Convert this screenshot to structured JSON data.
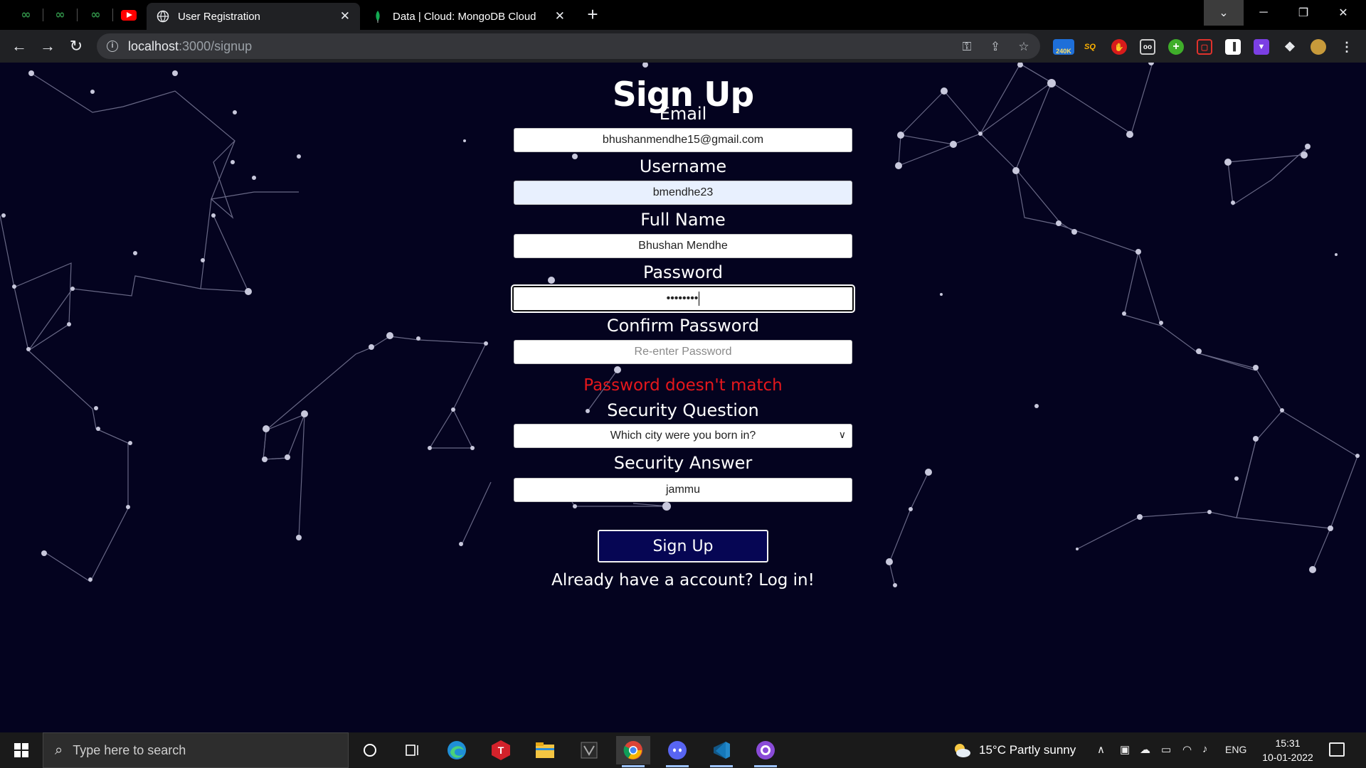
{
  "browser": {
    "tabs": [
      {
        "label": "User Registration",
        "active": true
      },
      {
        "label": "Data | Cloud: MongoDB Cloud",
        "active": false
      }
    ],
    "pinned_tabs": [
      "gfg-icon",
      "gfg-icon",
      "gfg-icon",
      "youtube-icon"
    ],
    "url": {
      "host": "localhost",
      "path": ":3000/signup"
    },
    "extension_badge": "240K",
    "extension_sq": "SQ"
  },
  "signup": {
    "title": "Sign Up",
    "email_label": "Email",
    "email_value": "bhushanmendhe15@gmail.com",
    "username_label": "Username",
    "username_value": "bmendhe23",
    "fullname_label": "Full Name",
    "fullname_value": "Bhushan Mendhe",
    "password_label": "Password",
    "password_value": "••••••••",
    "confirm_label": "Confirm Password",
    "confirm_placeholder": "Re-enter Password",
    "error_message": "Password doesn't match",
    "question_label": "Security Question",
    "question_value": "Which city were you born in?",
    "answer_label": "Security Answer",
    "answer_value": "jammu",
    "submit_label": "Sign Up",
    "login_text": "Already have a account? Log in!"
  },
  "taskbar": {
    "search_placeholder": "Type here to search",
    "weather": "15°C  Partly sunny",
    "language": "ENG",
    "time": "15:31",
    "date": "10-01-2022"
  },
  "colors": {
    "page_bg": "#04031f",
    "error": "#e5171c",
    "submit_bg": "#060654"
  }
}
